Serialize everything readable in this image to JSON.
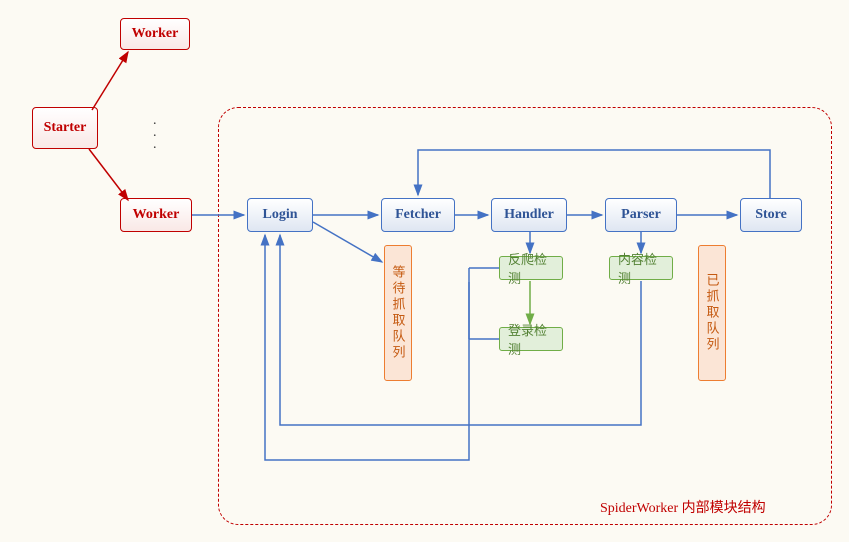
{
  "nodes": {
    "starter": "Starter",
    "worker_top": "Worker",
    "worker_bottom": "Worker",
    "login": "Login",
    "fetcher": "Fetcher",
    "handler": "Handler",
    "parser": "Parser",
    "store": "Store",
    "wait_queue": "等待抓取队列",
    "anticrawl": "反爬检测",
    "login_check": "登录检测",
    "content_check": "内容检测",
    "done_queue": "已抓取队列"
  },
  "caption": "SpiderWorker 内部模块结构",
  "colors": {
    "red": "#c00000",
    "blue": "#4472c4",
    "orange": "#ed7d31",
    "green": "#70ad47"
  }
}
